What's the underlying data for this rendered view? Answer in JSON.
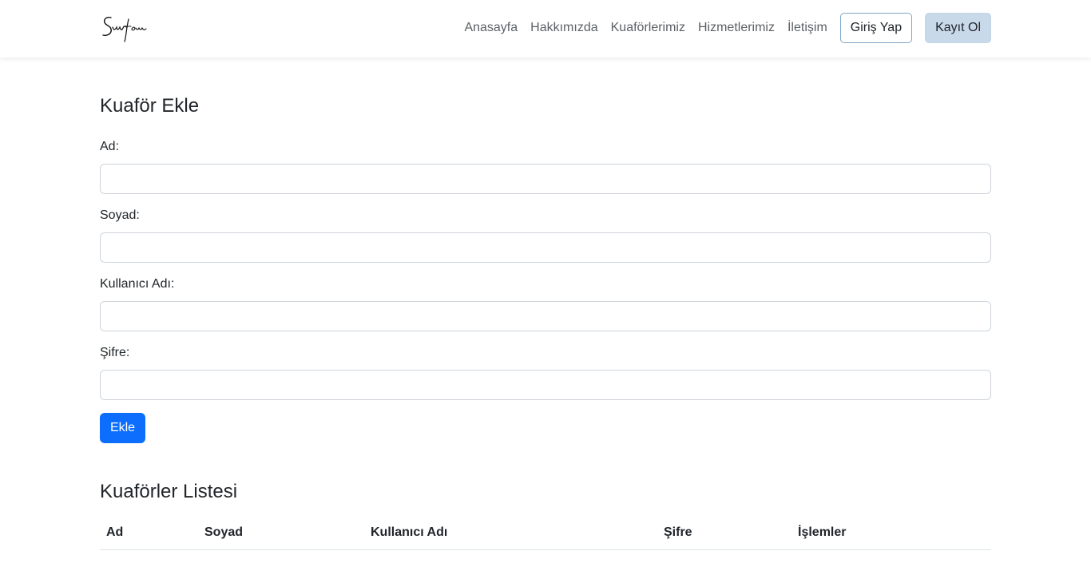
{
  "navbar": {
    "brand": "Sunfem",
    "links": [
      "Anasayfa",
      "Hakkımızda",
      "Kuaförlerimiz",
      "Hizmetlerimiz",
      "İletişim"
    ],
    "login_label": "Giriş Yap",
    "signup_label": "Kayıt Ol"
  },
  "form": {
    "title": "Kuaför Ekle",
    "fields": [
      {
        "label": "Ad:",
        "value": ""
      },
      {
        "label": "Soyad:",
        "value": ""
      },
      {
        "label": "Kullanıcı Adı:",
        "value": ""
      },
      {
        "label": "Şifre:",
        "value": ""
      }
    ],
    "submit_label": "Ekle"
  },
  "list": {
    "title": "Kuaförler Listesi",
    "columns": [
      "Ad",
      "Soyad",
      "Kullanıcı Adı",
      "Şifre",
      "İşlemler"
    ],
    "rows": []
  },
  "colors": {
    "primary": "#0d6efd",
    "signup_bg": "#c8d9ea",
    "login_border": "#7fa7c9"
  }
}
